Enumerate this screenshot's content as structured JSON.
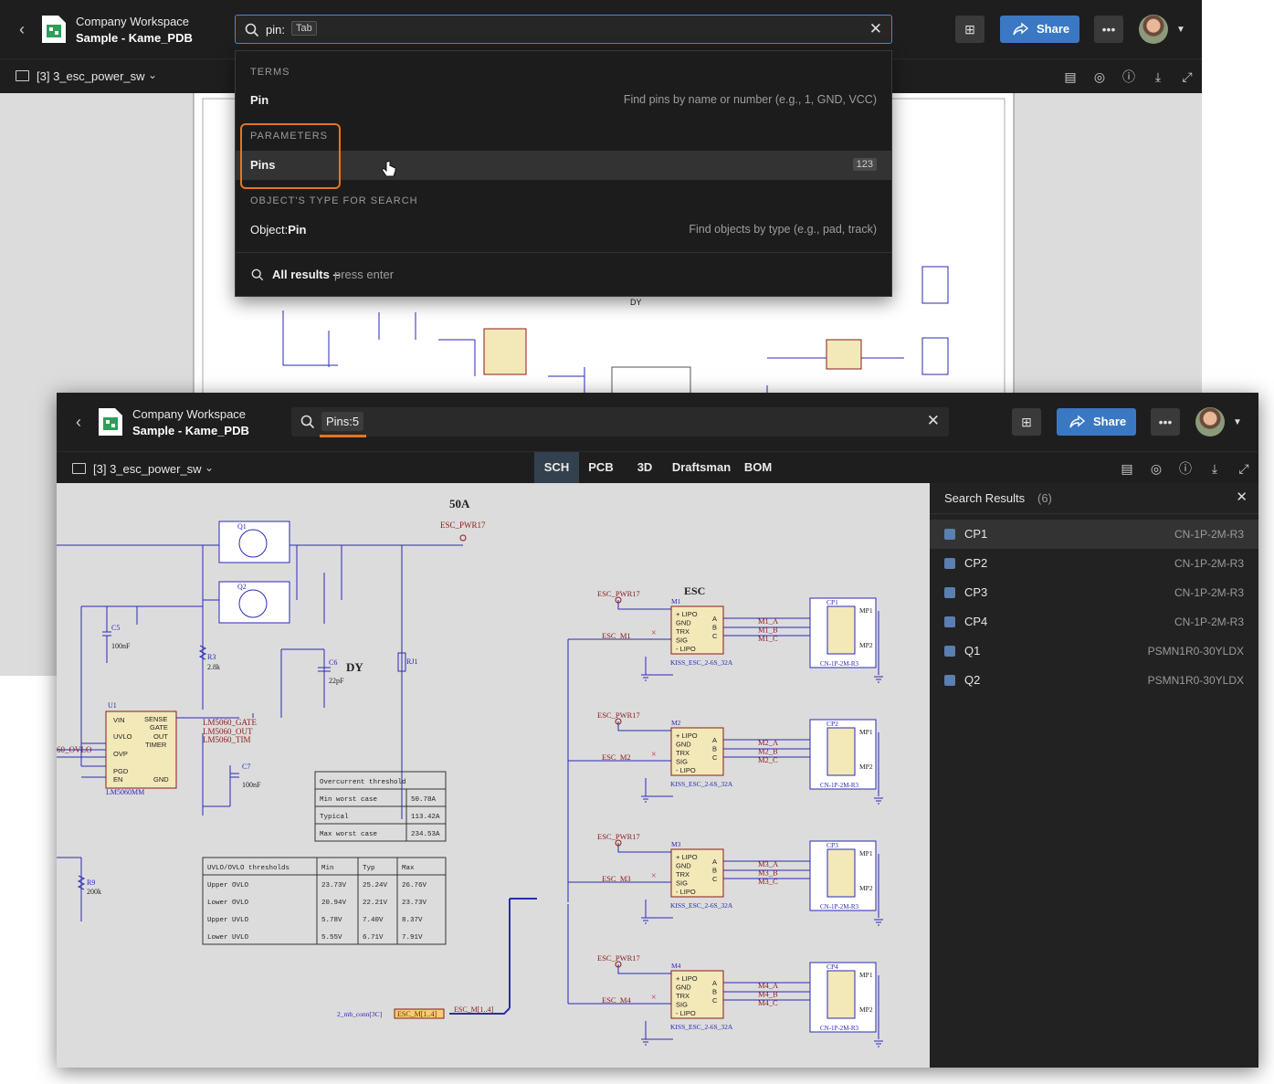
{
  "back_win": {
    "workspace": "Company Workspace",
    "project": "Sample - Kame_PDB",
    "search_value": "pin:",
    "search_hint": "Tab",
    "share": "Share",
    "doc_title": "[3] 3_esc_power_sw",
    "dropdown": {
      "terms_header": "TERMS",
      "terms_item": "Pin",
      "terms_desc": "Find pins by name or number (e.g., 1, GND, VCC)",
      "params_header": "PARAMETERS",
      "params_item": "Pins",
      "params_count": "123",
      "type_header": "OBJECT'S TYPE FOR SEARCH",
      "type_item_prefix": "Object:",
      "type_item": "Pin",
      "type_desc": "Find objects by type (e.g., pad, track)",
      "all_results": "All results –",
      "all_results_hint": "press enter"
    }
  },
  "front_win": {
    "workspace": "Company Workspace",
    "project": "Sample - Kame_PDB",
    "search_chip": "Pins:5",
    "share": "Share",
    "doc_title": "[3] 3_esc_power_sw",
    "tabs": [
      "SCH",
      "PCB",
      "3D",
      "Draftsman",
      "BOM"
    ],
    "active_tab": "SCH",
    "results": {
      "title": "Search Results",
      "count": "(6)",
      "items": [
        {
          "name": "CP1",
          "part": "CN-1P-2M-R3"
        },
        {
          "name": "CP2",
          "part": "CN-1P-2M-R3"
        },
        {
          "name": "CP3",
          "part": "CN-1P-2M-R3"
        },
        {
          "name": "CP4",
          "part": "CN-1P-2M-R3"
        },
        {
          "name": "Q1",
          "part": "PSMN1R0-30YLDX"
        },
        {
          "name": "Q2",
          "part": "PSMN1R0-30YLDX"
        }
      ]
    },
    "schematic": {
      "current": "50A",
      "net_esc_pwr": "ESC_PWR17",
      "esc_label": "ESC",
      "dy": "DY",
      "q1": "Q1",
      "q2": "Q2",
      "c5": "C5",
      "c5v": "100nF",
      "c6": "C6",
      "c6v": "22pF",
      "c7": "C7",
      "c7v": "100nF",
      "r3": "R3",
      "r3v": "2.8k",
      "r9": "R9",
      "r9v": "200k",
      "rj1": "RJ1",
      "u1": "U1",
      "u1part": "LM5060MM",
      "u1_pins_left": [
        "VIN",
        "UVLO",
        "OVP",
        "PGD",
        "EN"
      ],
      "u1_pins_right": [
        "SENSE",
        "GATE",
        "OUT",
        "TIMER",
        "GND"
      ],
      "net_gate": "LM5060_GATE",
      "net_out": "LM5060_OUT",
      "net_tim": "LM5060_TIM",
      "net_ovlo": "60_OVLO",
      "oc_table": {
        "title": "Overcurrent threshold",
        "rows": [
          [
            "Min worst case",
            "50.78A"
          ],
          [
            "Typical",
            "113.42A"
          ],
          [
            "Max worst case",
            "234.53A"
          ]
        ]
      },
      "uv_table": {
        "header": [
          "UVLO/OVLO thresholds",
          "Min",
          "Typ",
          "Max"
        ],
        "rows": [
          [
            "Upper OVLO",
            "23.73V",
            "25.24V",
            "26.76V"
          ],
          [
            "Lower OVLO",
            "20.94V",
            "22.21V",
            "23.73V"
          ],
          [
            "Upper UVLO",
            "5.78V",
            "7.40V",
            "8.37V"
          ],
          [
            "Lower UVLO",
            "5.55V",
            "6.71V",
            "7.91V"
          ]
        ]
      },
      "esc_pins_left": [
        "+ LIPO",
        "GND",
        "TRX",
        "SIG",
        "- LIPO"
      ],
      "esc_pins_right": [
        "A",
        "B",
        "C"
      ],
      "esc_part": "KISS_ESC_2-6S_32A",
      "cp_part": "CN-1P-2M-R3",
      "mp1": "MP1",
      "mp2": "MP2",
      "bus_net": "ESC_M[1..4]",
      "bus_port": "ESC_M[1..4]",
      "bus_sheet": "2_mb_conn[3C]",
      "escs": [
        {
          "m": "M1",
          "cp": "CP1",
          "net": "ESC_M1",
          "pwr": "ESC_PWR17",
          "a": "M1_A",
          "b": "M1_B",
          "c": "M1_C"
        },
        {
          "m": "M2",
          "cp": "CP2",
          "net": "ESC_M2",
          "pwr": "ESC_PWR17",
          "a": "M2_A",
          "b": "M2_B",
          "c": "M2_C"
        },
        {
          "m": "M3",
          "cp": "CP3",
          "net": "ESC_M3",
          "pwr": "ESC_PWR17",
          "a": "M3_A",
          "b": "M3_B",
          "c": "M3_C"
        },
        {
          "m": "M4",
          "cp": "CP4",
          "net": "ESC_M4",
          "pwr": "ESC_PWR17",
          "a": "M4_A",
          "b": "M4_B",
          "c": "M4_C"
        }
      ]
    }
  },
  "colors": {
    "accent": "#3b78c3",
    "highlight": "#e8741e",
    "wire": "#2a2ab8",
    "netlabel": "#8b1a1a",
    "component_fill": "#f3e8b8"
  }
}
